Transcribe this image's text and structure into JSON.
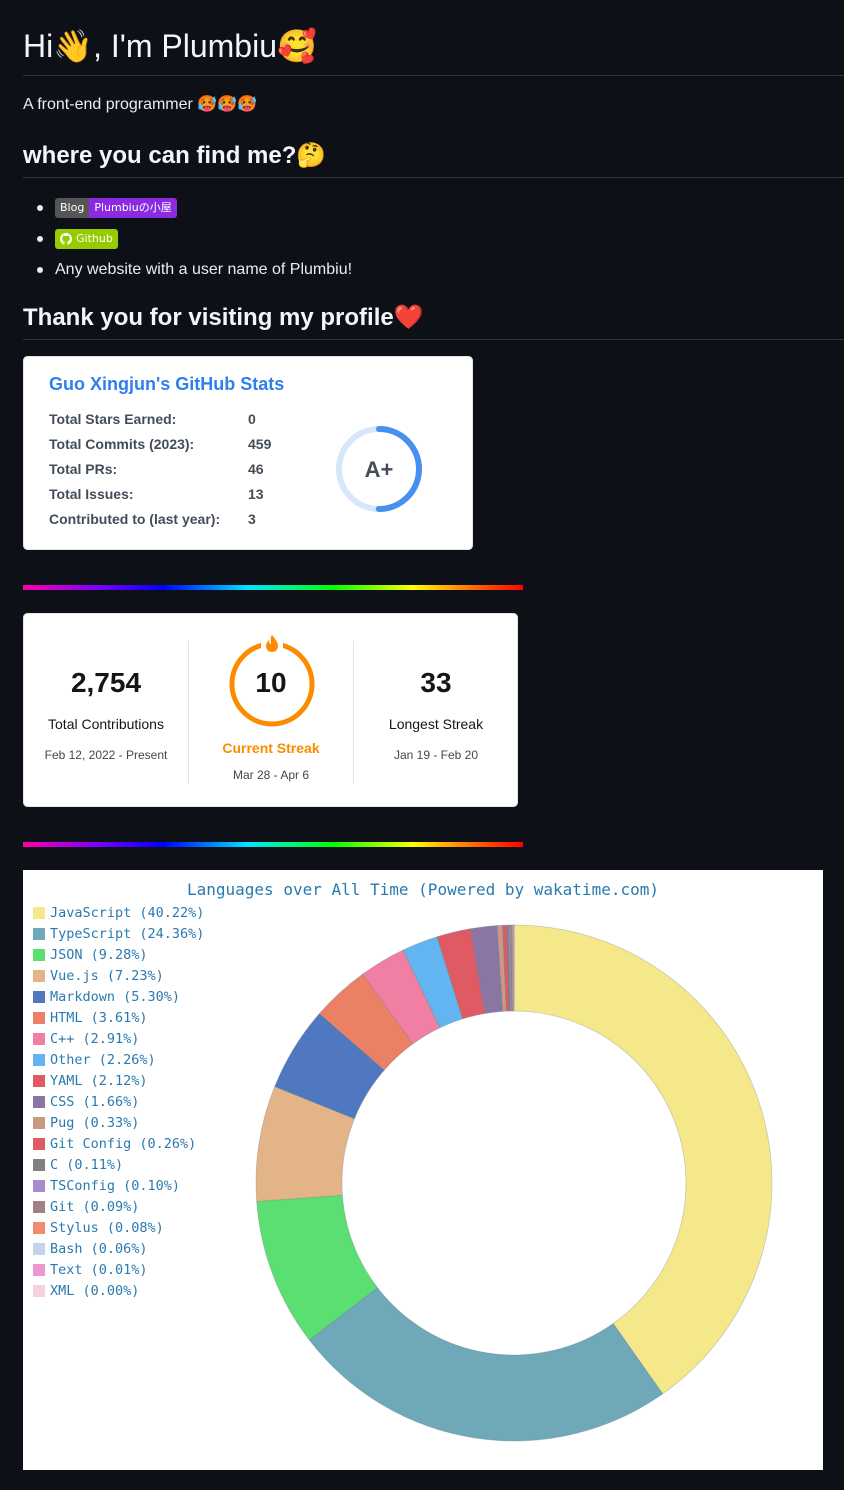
{
  "header": {
    "title": "Hi👋, I'm Plumbiu🥰",
    "intro": "A front-end programmer 🥵🥵🥵"
  },
  "find_section": {
    "heading": "where you can find me?🤔",
    "blog_badge_left": "Blog",
    "blog_badge_right": "Plumbiuの小屋",
    "github_badge": "Github",
    "any_website": "Any website with a user name of Plumbiu!"
  },
  "thanks_heading": "Thank you for visiting my profile❤️",
  "stats_card": {
    "title": "Guo Xingjun's GitHub Stats",
    "rows": [
      {
        "label": "Total Stars Earned:",
        "value": "0"
      },
      {
        "label": "Total Commits (2023):",
        "value": "459"
      },
      {
        "label": "Total PRs:",
        "value": "46"
      },
      {
        "label": "Total Issues:",
        "value": "13"
      },
      {
        "label": "Contributed to (last year):",
        "value": "3"
      }
    ],
    "rank": "A+",
    "accent": "#2f80ed"
  },
  "streak_card": {
    "total_contributions": "2,754",
    "total_label": "Total Contributions",
    "total_range": "Feb 12, 2022 - Present",
    "current_streak": "10",
    "current_label": "Current Streak",
    "current_range": "Mar 28 - Apr 6",
    "longest_streak": "33",
    "longest_label": "Longest Streak",
    "longest_range": "Jan 19 - Feb 20",
    "accent": "#fb8c00"
  },
  "chart_data": {
    "type": "pie",
    "title": "Languages over All Time (Powered by wakatime.com)",
    "categories": [
      "JavaScript",
      "TypeScript",
      "JSON",
      "Vue.js",
      "Markdown",
      "HTML",
      "C++",
      "Other",
      "YAML",
      "CSS",
      "Pug",
      "Git Config",
      "C",
      "TSConfig",
      "Git",
      "Stylus",
      "Bash",
      "Text",
      "XML"
    ],
    "values": [
      40.22,
      24.36,
      9.28,
      7.23,
      5.3,
      3.61,
      2.91,
      2.26,
      2.12,
      1.66,
      0.33,
      0.26,
      0.11,
      0.1,
      0.09,
      0.08,
      0.06,
      0.01,
      0.0
    ],
    "legend_labels": [
      "JavaScript (40.22%)",
      "TypeScript (24.36%)",
      "JSON (9.28%)",
      "Vue.js (7.23%)",
      "Markdown (5.30%)",
      "HTML (3.61%)",
      "C++ (2.91%)",
      "Other (2.26%)",
      "YAML (2.12%)",
      "CSS (1.66%)",
      "Pug (0.33%)",
      "Git Config (0.26%)",
      "C (0.11%)",
      "TSConfig (0.10%)",
      "Git (0.09%)",
      "Stylus (0.08%)",
      "Bash (0.06%)",
      "Text (0.01%)",
      "XML (0.00%)"
    ],
    "colors": [
      "#f5e88a",
      "#6fa8b8",
      "#5bde72",
      "#e4b489",
      "#5078c0",
      "#ea8064",
      "#f17fa3",
      "#62b5f0",
      "#e05a63",
      "#8a76a3",
      "#c89a86",
      "#e05a63",
      "#808080",
      "#a78bcd",
      "#a08080",
      "#f28a72",
      "#c4d4ec",
      "#ea9ad0",
      "#f6cfe0"
    ],
    "legend": "top-left"
  }
}
